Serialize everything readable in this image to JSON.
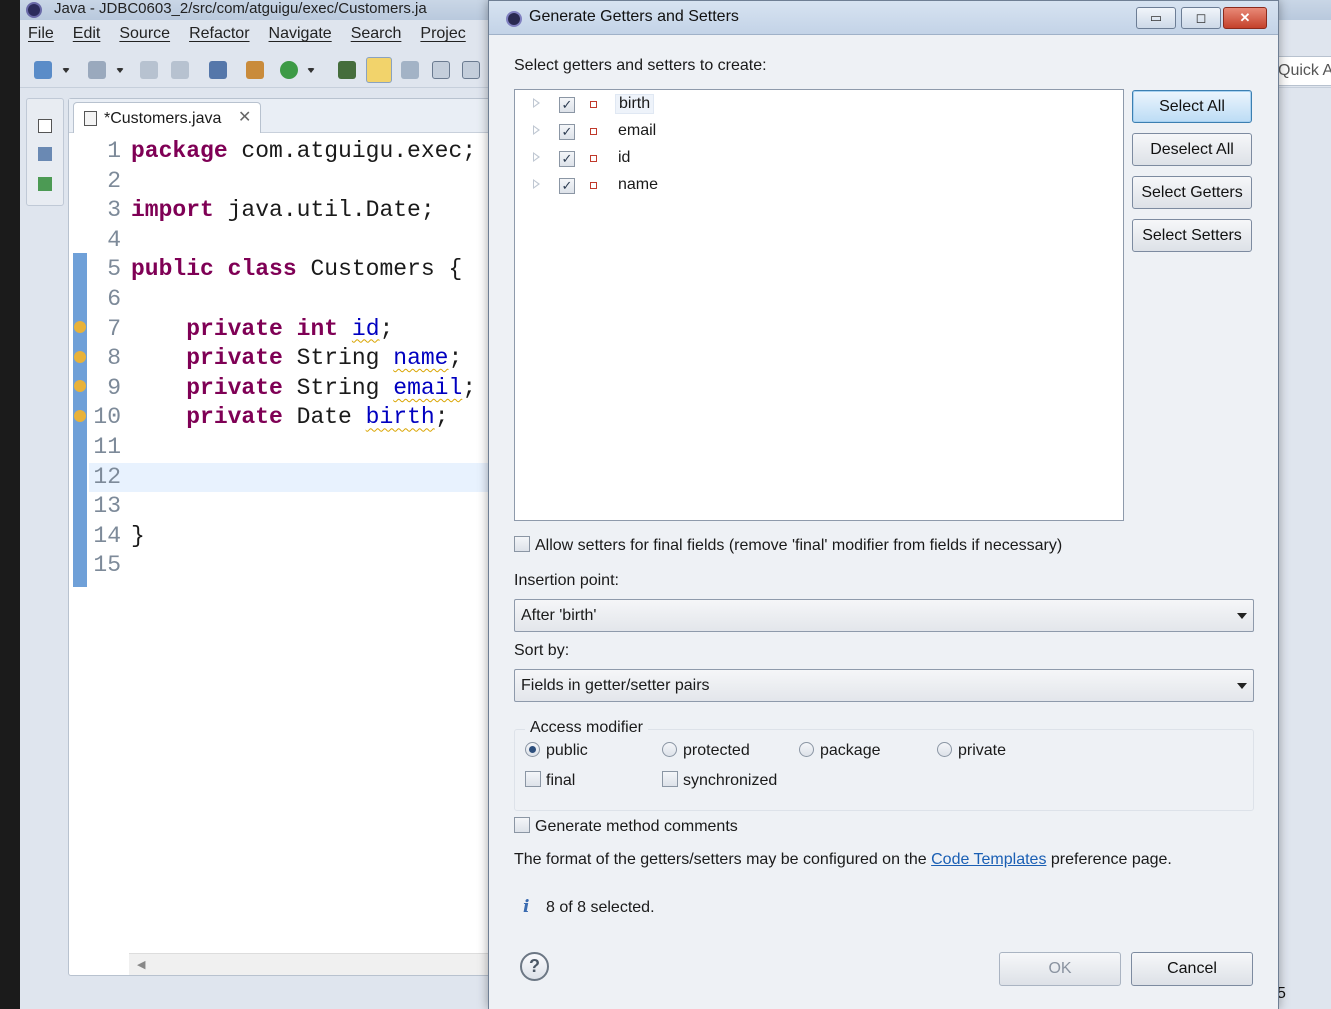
{
  "eclipse": {
    "window_title": "Java - JDBC0603_2/src/com/atguigu/exec/Customers.ja",
    "menu": [
      "File",
      "Edit",
      "Source",
      "Refactor",
      "Navigate",
      "Search",
      "Projec"
    ],
    "quick_access": "Quick A",
    "status_fragment": "5",
    "editor": {
      "tab_label": "*Customers.java",
      "tab_close": "✕",
      "lines": [
        {
          "n": "1"
        },
        {
          "n": "2"
        },
        {
          "n": "3"
        },
        {
          "n": "4"
        },
        {
          "n": "5"
        },
        {
          "n": "6"
        },
        {
          "n": "7"
        },
        {
          "n": "8"
        },
        {
          "n": "9"
        },
        {
          "n": "10"
        },
        {
          "n": "11"
        },
        {
          "n": "12"
        },
        {
          "n": "13"
        },
        {
          "n": "14"
        },
        {
          "n": "15"
        }
      ],
      "code": {
        "l1_kw": "package",
        "l1_rest": " com.atguigu.exec;",
        "l3_kw": "import",
        "l3_rest": " java.util.Date;",
        "l5_kw1": "public",
        "l5_kw2": "class",
        "l5_rest": " Customers {",
        "l7_kw1": "private",
        "l7_kw2": "int",
        "l7_field": "id",
        "l7_end": ";",
        "l8_kw1": "private",
        "l8_type": " String ",
        "l8_field": "name",
        "l8_end": ";",
        "l9_kw1": "private",
        "l9_type": " String ",
        "l9_field": "email",
        "l9_end": ";",
        "l10_kw1": "private",
        "l10_type": " Date ",
        "l10_field": "birth",
        "l10_end": ";",
        "l14": "}"
      }
    }
  },
  "dialog": {
    "title": "Generate Getters and Setters",
    "window_buttons": {
      "minimize": "▭",
      "maximize": "◻",
      "close": "✕"
    },
    "prompt": "Select getters and setters to create:",
    "fields": [
      {
        "name": "birth",
        "checked": "✓"
      },
      {
        "name": "email",
        "checked": "✓"
      },
      {
        "name": "id",
        "checked": "✓"
      },
      {
        "name": "name",
        "checked": "✓"
      }
    ],
    "side_buttons": {
      "select_all": "Select All",
      "deselect_all": "Deselect All",
      "select_getters": "Select Getters",
      "select_setters": "Select Setters"
    },
    "allow_final_setters": "Allow setters for final fields (remove 'final' modifier from fields if necessary)",
    "insertion_point_label": "Insertion point:",
    "insertion_point_value": "After 'birth'",
    "sort_by_label": "Sort by:",
    "sort_by_value": "Fields in getter/setter pairs",
    "access_modifier": {
      "title": "Access modifier",
      "options": [
        "public",
        "protected",
        "package",
        "private"
      ],
      "selected": "public",
      "final_label": "final",
      "synchronized_label": "synchronized"
    },
    "generate_comments": "Generate method comments",
    "format_text_before": "The format of the getters/setters may be configured on the ",
    "format_link": "Code Templates",
    "format_text_after": " preference page.",
    "status_icon": "i",
    "status": "8 of 8 selected.",
    "help_icon": "?",
    "ok": "OK",
    "cancel": "Cancel"
  }
}
